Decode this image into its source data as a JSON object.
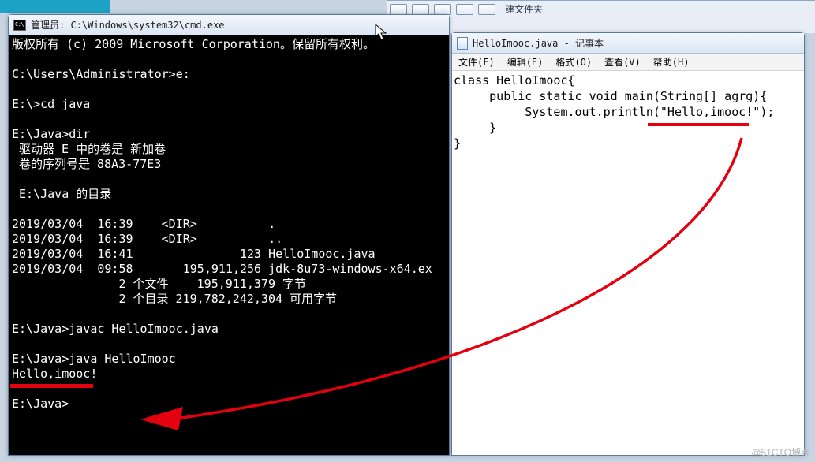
{
  "explorer": {
    "label": "建文件夹"
  },
  "cmd": {
    "title": "管理员: C:\\Windows\\system32\\cmd.exe",
    "lines": [
      "版权所有 (c) 2009 Microsoft Corporation。保留所有权利。",
      "",
      "C:\\Users\\Administrator>e:",
      "",
      "E:\\>cd java",
      "",
      "E:\\Java>dir",
      " 驱动器 E 中的卷是 新加卷",
      " 卷的序列号是 88A3-77E3",
      "",
      " E:\\Java 的目录",
      "",
      "2019/03/04  16:39    <DIR>          .",
      "2019/03/04  16:39    <DIR>          ..",
      "2019/03/04  16:41               123 HelloImooc.java",
      "2019/03/04  09:58       195,911,256 jdk-8u73-windows-x64.ex",
      "               2 个文件    195,911,379 字节",
      "               2 个目录 219,782,242,304 可用字节",
      "",
      "E:\\Java>javac HelloImooc.java",
      "",
      "E:\\Java>java HelloImooc",
      "Hello,imooc!",
      "",
      "E:\\Java>"
    ]
  },
  "notepad": {
    "title": "HelloImooc.java - 记事本",
    "menu": [
      "文件(F)",
      "编辑(E)",
      "格式(O)",
      "查看(V)",
      "帮助(H)"
    ],
    "code": [
      "class HelloImooc{",
      "     public static void main(String[] agrg){",
      "          System.out.println(\"Hello,imooc!\");",
      "     }",
      "}"
    ]
  },
  "watermark": "@51CTO博客"
}
